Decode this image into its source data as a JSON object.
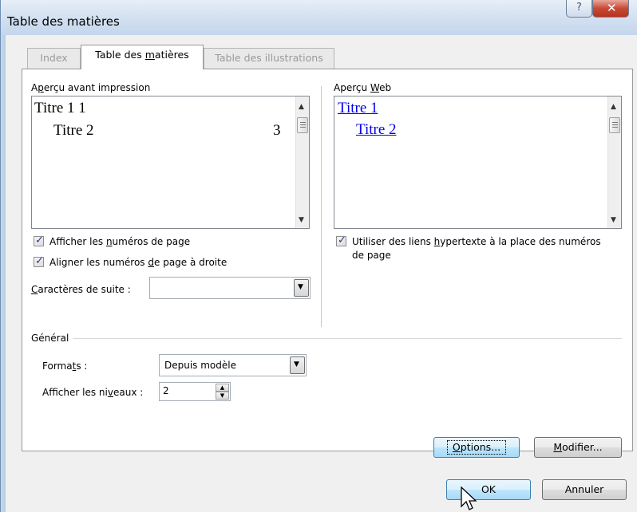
{
  "window": {
    "title": "Table des matières",
    "help_glyph": "?",
    "close_glyph": "✕"
  },
  "tabs": [
    {
      "label": "Index",
      "active": false
    },
    {
      "label": "Table des matières",
      "active": true
    },
    {
      "label": "Table des illustrations",
      "active": false
    }
  ],
  "print_preview": {
    "label": "Aperçu avant impression",
    "heading1": "Titre 1 1",
    "heading2": "Titre 2",
    "heading2_page": "3"
  },
  "web_preview": {
    "label": "Aperçu Web",
    "heading1": "Titre 1",
    "heading2": "Titre 2"
  },
  "options": {
    "show_page_numbers": {
      "label": "Afficher les numéros de page",
      "checked": true
    },
    "align_right": {
      "label": "Aligner les numéros de page à droite",
      "checked": true
    },
    "hyperlinks": {
      "label_line1": "Utiliser des liens hypertexte à la place des numéros",
      "label_line2": "de page",
      "checked": true
    },
    "tab_leader": {
      "label": "Caractères de suite :",
      "value": ""
    }
  },
  "general": {
    "label": "Général",
    "formats_label": "Formats :",
    "formats_value": "Depuis modèle",
    "levels_label": "Afficher les niveaux :",
    "levels_value": "2"
  },
  "buttons": {
    "options": "Options...",
    "modify": "Modifier...",
    "ok": "OK",
    "cancel": "Annuler"
  },
  "colors": {
    "link": "#0000ee",
    "titlebar": "#c4d6ec",
    "close_button": "#c84a35"
  }
}
